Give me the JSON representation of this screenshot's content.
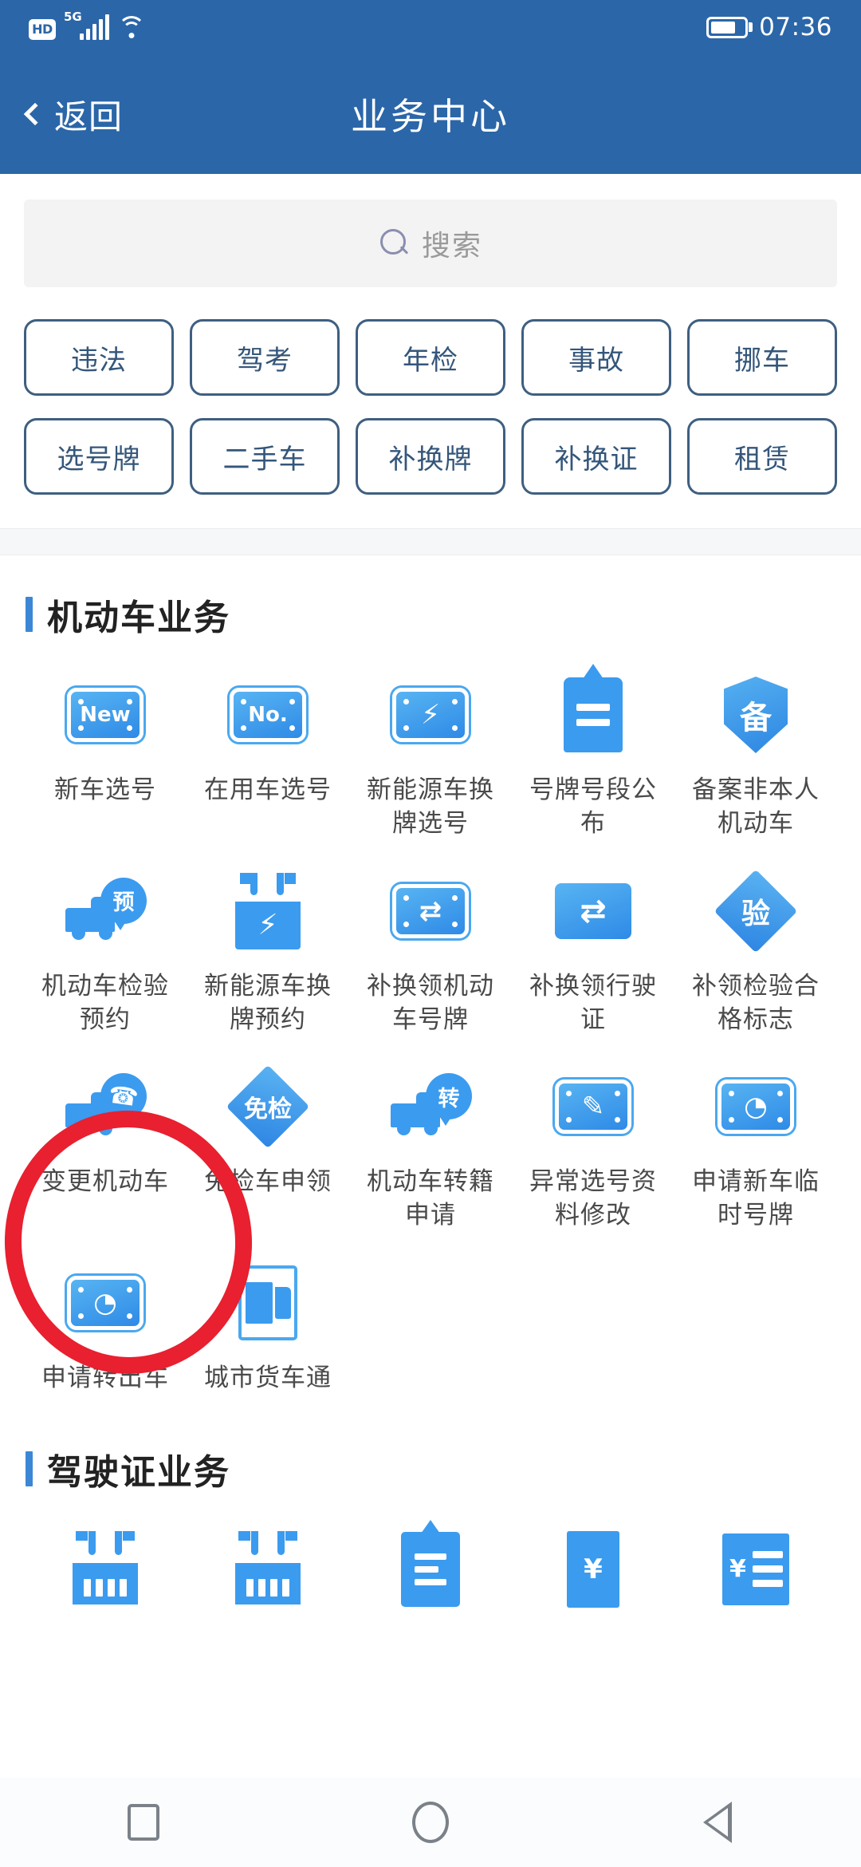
{
  "status_bar": {
    "hd_badge": "HD",
    "network_type": "5G",
    "signal_icon": "signal-bars-icon",
    "wifi_icon": "wifi-icon",
    "battery_icon": "battery-icon",
    "battery_level_percent": 75,
    "time": "07:36"
  },
  "header": {
    "back_label": "返回",
    "back_icon": "chevron-left-icon",
    "title": "业务中心"
  },
  "search": {
    "icon": "search-icon",
    "placeholder": "搜索",
    "value": ""
  },
  "quick_tags": {
    "row1": [
      {
        "label": "违法"
      },
      {
        "label": "驾考"
      },
      {
        "label": "年检"
      },
      {
        "label": "事故"
      },
      {
        "label": "挪车"
      }
    ],
    "row2": [
      {
        "label": "选号牌"
      },
      {
        "label": "二手车"
      },
      {
        "label": "补换牌"
      },
      {
        "label": "补换证"
      },
      {
        "label": "租赁"
      }
    ]
  },
  "sections": [
    {
      "title": "机动车业务",
      "items": [
        {
          "label": "新车选号",
          "icon": "license-plate-new-icon",
          "glyph": "New"
        },
        {
          "label": "在用车选号",
          "icon": "license-plate-no-icon",
          "glyph": "No."
        },
        {
          "label": "新能源车换牌选号",
          "icon": "license-plate-lightning-icon",
          "glyph": "⚡"
        },
        {
          "label": "号牌号段公布",
          "icon": "hanging-tag-icon",
          "glyph": ""
        },
        {
          "label": "备案非本人机动车",
          "icon": "shield-record-icon",
          "glyph": "备"
        },
        {
          "label": "机动车检验预约",
          "icon": "truck-appointment-icon",
          "glyph": "预"
        },
        {
          "label": "新能源车换牌预约",
          "icon": "battery-charge-icon",
          "glyph": "⚡"
        },
        {
          "label": "补换领机动车号牌",
          "icon": "license-plate-exchange-icon",
          "glyph": "⇄"
        },
        {
          "label": "补换领行驶证",
          "icon": "vehicle-exchange-icon",
          "glyph": "⇄"
        },
        {
          "label": "补领检验合格标志",
          "icon": "diamond-inspect-icon",
          "glyph": "验"
        },
        {
          "label": "变更机动车",
          "icon": "truck-phone-icon",
          "glyph": "☎"
        },
        {
          "label": "免检车申领",
          "icon": "diamond-exempt-icon",
          "glyph": "免检"
        },
        {
          "label": "机动车转籍申请",
          "icon": "truck-transfer-icon",
          "glyph": "转"
        },
        {
          "label": "异常选号资料修改",
          "icon": "license-plate-edit-icon",
          "glyph": "✎"
        },
        {
          "label": "申请新车临时号牌",
          "icon": "license-plate-clock-icon",
          "glyph": "◔"
        },
        {
          "label": "申请转出车",
          "icon": "license-plate-clock-icon",
          "glyph": "◔"
        },
        {
          "label": "城市货车通",
          "icon": "city-truck-icon",
          "glyph": ""
        }
      ]
    },
    {
      "title": "驾驶证业务",
      "items": [
        {
          "label": "",
          "icon": "meter-icon",
          "glyph": ""
        },
        {
          "label": "",
          "icon": "meter-icon",
          "glyph": ""
        },
        {
          "label": "",
          "icon": "tag-check-icon",
          "glyph": ""
        },
        {
          "label": "",
          "icon": "yen-edit-icon",
          "glyph": "¥"
        },
        {
          "label": "",
          "icon": "yen-list-icon",
          "glyph": "¥"
        }
      ]
    }
  ],
  "annotation": {
    "shape": "red-circle-highlight",
    "target_label": "变更机动车",
    "color": "#e8202f"
  },
  "nav_bar": {
    "recents_icon": "square-recents-icon",
    "home_icon": "circle-home-icon",
    "back_icon": "triangle-back-icon"
  },
  "colors": {
    "header_blue": "#2b66a8",
    "icon_blue": "#3b9bef",
    "chip_border": "#3e5f80",
    "accent_red": "#e8202f"
  }
}
